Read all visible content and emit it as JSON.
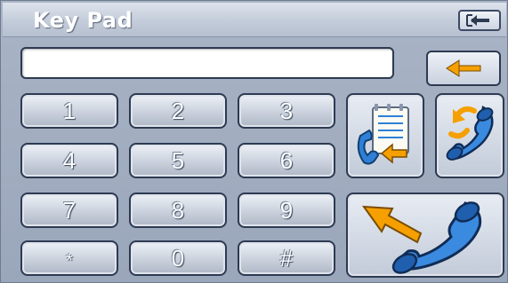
{
  "window": {
    "title": "Key Pad"
  },
  "display": {
    "value": ""
  },
  "keypad": [
    {
      "label": "1"
    },
    {
      "label": "2"
    },
    {
      "label": "3"
    },
    {
      "label": "4"
    },
    {
      "label": "5"
    },
    {
      "label": "6"
    },
    {
      "label": "7"
    },
    {
      "label": "8"
    },
    {
      "label": "9"
    },
    {
      "label": "*"
    },
    {
      "label": "0"
    },
    {
      "label": "#"
    }
  ],
  "icons": {
    "exit": "exit-door-icon",
    "backspace": "back-arrow-icon",
    "contacts": "phonebook-icon",
    "redial": "redial-phone-icon",
    "call": "call-phone-icon"
  },
  "colors": {
    "accent": "#f5a000",
    "frame": "#2d3a52",
    "phone_blue": "#2f7fd8"
  }
}
